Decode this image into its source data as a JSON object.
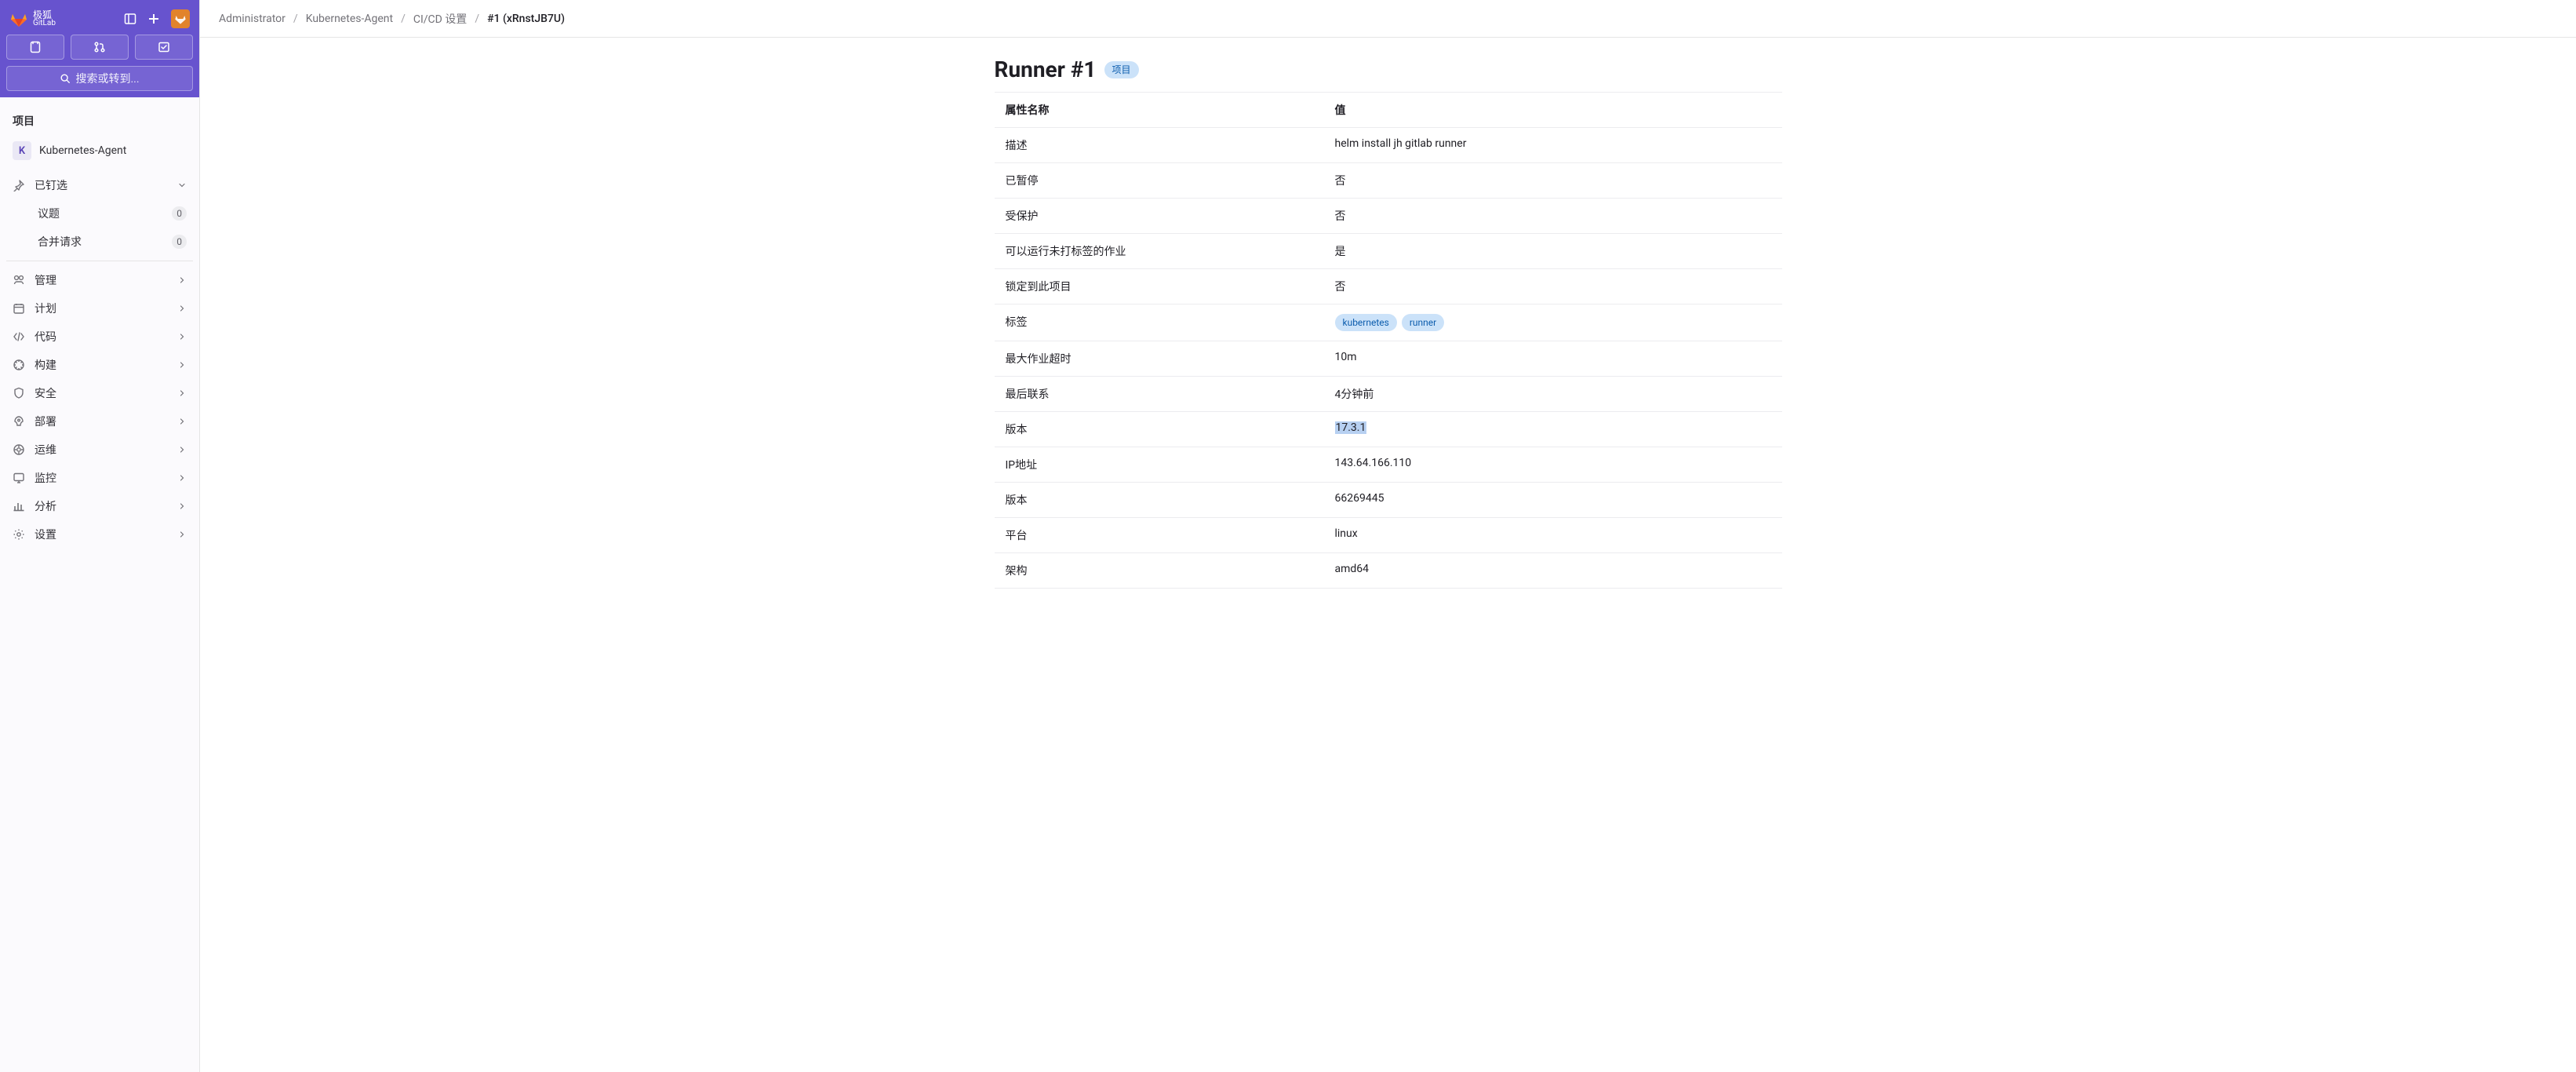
{
  "brand": {
    "line1": "极狐",
    "line2": "GitLab"
  },
  "search_placeholder": "搜索或转到...",
  "section_title": "项目",
  "project": {
    "initial": "K",
    "name": "Kubernetes-Agent"
  },
  "pinned": {
    "label": "已钉选",
    "items": [
      {
        "label": "议题",
        "count": "0"
      },
      {
        "label": "合并请求",
        "count": "0"
      }
    ]
  },
  "nav": [
    {
      "key": "manage",
      "label": "管理"
    },
    {
      "key": "plan",
      "label": "计划"
    },
    {
      "key": "code",
      "label": "代码"
    },
    {
      "key": "build",
      "label": "构建"
    },
    {
      "key": "secure",
      "label": "安全"
    },
    {
      "key": "deploy",
      "label": "部署"
    },
    {
      "key": "operate",
      "label": "运维"
    },
    {
      "key": "monitor",
      "label": "监控"
    },
    {
      "key": "analyze",
      "label": "分析"
    },
    {
      "key": "settings",
      "label": "设置"
    }
  ],
  "breadcrumb": {
    "a": "Administrator",
    "b": "Kubernetes-Agent",
    "c": "CI/CD 设置",
    "d": "#1 (xRnstJB7U)"
  },
  "page": {
    "title": "Runner #1",
    "badge": "项目"
  },
  "table": {
    "header_key": "属性名称",
    "header_val": "值",
    "rows": [
      {
        "key": "描述",
        "val": "helm install jh gitlab runner",
        "type": "text"
      },
      {
        "key": "已暂停",
        "val": "否",
        "type": "text"
      },
      {
        "key": "受保护",
        "val": "否",
        "type": "text"
      },
      {
        "key": "可以运行未打标签的作业",
        "val": "是",
        "type": "text"
      },
      {
        "key": "锁定到此项目",
        "val": "否",
        "type": "text"
      },
      {
        "key": "标签",
        "type": "tags",
        "tags": [
          "kubernetes",
          "runner"
        ]
      },
      {
        "key": "最大作业超时",
        "val": "10m",
        "type": "text"
      },
      {
        "key": "最后联系",
        "val": "4分钟前",
        "type": "text"
      },
      {
        "key": "版本",
        "val": "17.3.1",
        "type": "highlight"
      },
      {
        "key": "IP地址",
        "val": "143.64.166.110",
        "type": "text"
      },
      {
        "key": "版本",
        "val": "66269445",
        "type": "text"
      },
      {
        "key": "平台",
        "val": "linux",
        "type": "text"
      },
      {
        "key": "架构",
        "val": "amd64",
        "type": "text"
      }
    ]
  }
}
